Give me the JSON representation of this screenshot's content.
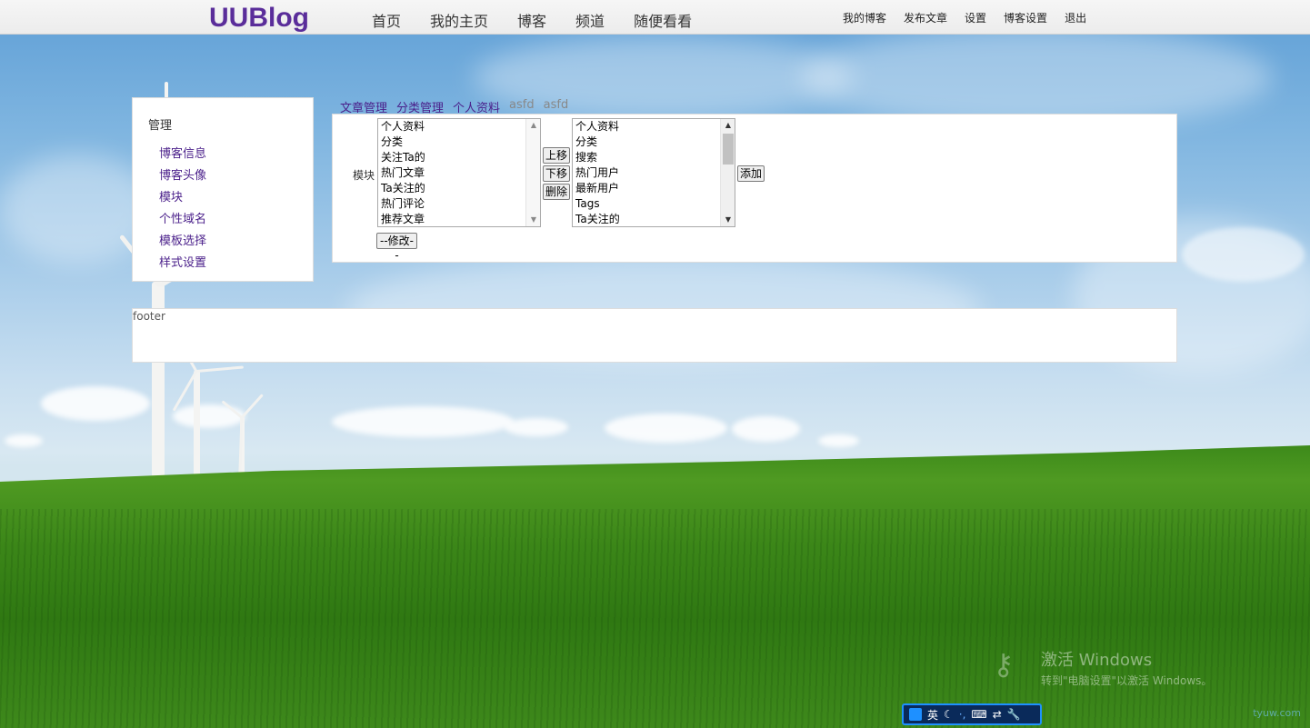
{
  "logo": "UUBlog",
  "main_nav": [
    "首页",
    "我的主页",
    "博客",
    "频道",
    "随便看看"
  ],
  "user_nav": [
    "我的博客",
    "发布文章",
    "设置",
    "博客设置",
    "退出"
  ],
  "sidebar": {
    "title": "管理",
    "items": [
      "博客信息",
      "博客头像",
      "模块",
      "个性域名",
      "模板选择",
      "样式设置"
    ]
  },
  "tabs": [
    {
      "label": "文章管理",
      "state": "link"
    },
    {
      "label": "分类管理",
      "state": "link"
    },
    {
      "label": "个人资料",
      "state": "link"
    },
    {
      "label": "asfd",
      "state": "muted"
    },
    {
      "label": "asfd",
      "state": "muted"
    }
  ],
  "module_editor": {
    "label": "模块",
    "current_modules": [
      "个人资料",
      "分类",
      "关注Ta的",
      "热门文章",
      "Ta关注的",
      "热门评论",
      "推荐文章"
    ],
    "available_modules": [
      "个人资料",
      "分类",
      "搜索",
      "热门用户",
      "最新用户",
      "Tags",
      "Ta关注的"
    ],
    "move_up_label": "上移",
    "move_down_label": "下移",
    "delete_label": "删除",
    "add_label": "添加",
    "modify_label": "--修改--"
  },
  "footer_text": "footer",
  "watermark": {
    "title": "激活 Windows",
    "subtitle": "转到\"电脑设置\"以激活 Windows。"
  },
  "ime_bar": {
    "mode": "英"
  },
  "corner_logo": "tyuw.com",
  "colors": {
    "accent_purple": "#5a2d9a",
    "link_purple": "#4a1f8a",
    "ime_border": "#1e90ff"
  }
}
